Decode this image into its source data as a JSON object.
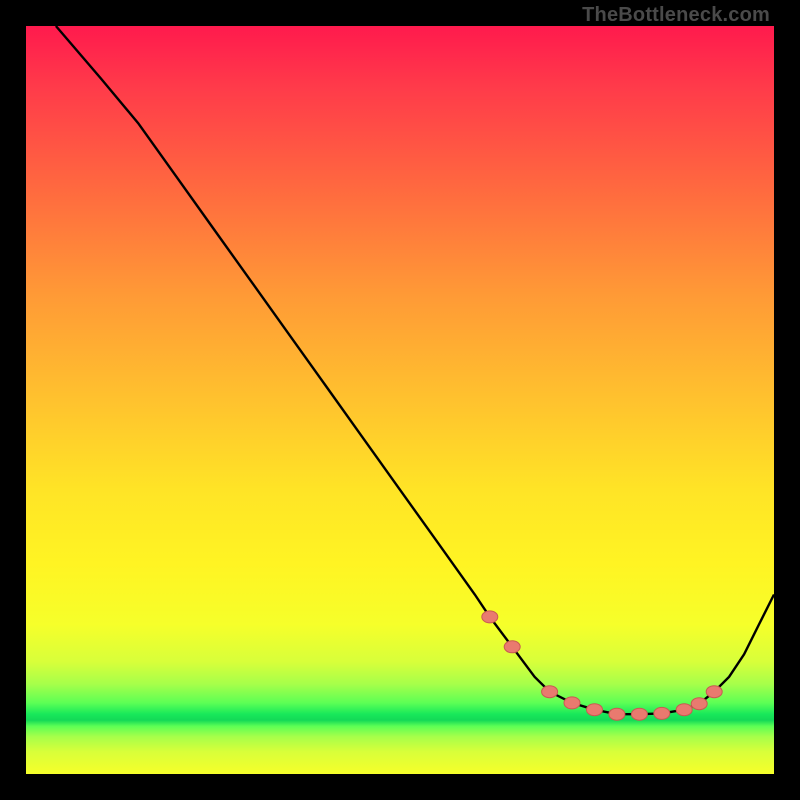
{
  "watermark": {
    "text": "TheBottleneck.com"
  },
  "colors": {
    "curve": "#000000",
    "marker_fill": "#e97a6f",
    "marker_stroke": "#c95a52"
  },
  "chart_data": {
    "type": "line",
    "title": "",
    "xlabel": "",
    "ylabel": "",
    "xlim": [
      0,
      100
    ],
    "ylim": [
      0,
      100
    ],
    "grid": false,
    "legend": false,
    "series": [
      {
        "name": "curve",
        "x": [
          4,
          10,
          15,
          20,
          25,
          30,
          35,
          40,
          45,
          50,
          55,
          60,
          62,
          65,
          68,
          70,
          73,
          76,
          79,
          82,
          85,
          88,
          90,
          92,
          94,
          96,
          98,
          100
        ],
        "y": [
          100,
          93,
          87,
          80,
          73,
          66,
          59,
          52,
          45,
          38,
          31,
          24,
          21,
          17,
          13,
          11,
          9.5,
          8.6,
          8.0,
          8.0,
          8.1,
          8.6,
          9.4,
          11,
          13,
          16,
          20,
          24
        ]
      }
    ],
    "markers": {
      "name": "points",
      "x": [
        62,
        65,
        70,
        73,
        76,
        79,
        82,
        85,
        88,
        90,
        92
      ],
      "y": [
        21,
        17,
        11,
        9.5,
        8.6,
        8.0,
        8.0,
        8.1,
        8.6,
        9.4,
        11
      ]
    }
  }
}
